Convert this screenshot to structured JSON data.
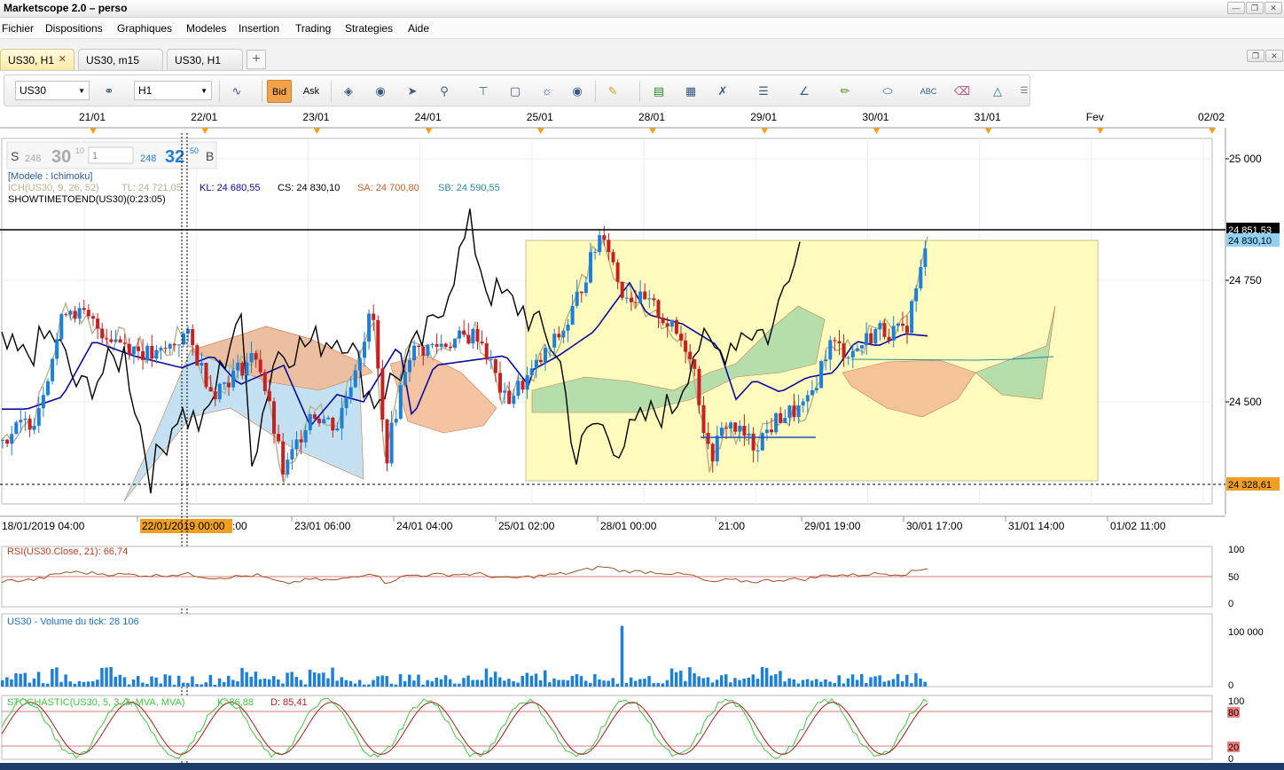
{
  "app": {
    "title": "Marketscope 2.0 – perso"
  },
  "menu": [
    "Fichier",
    "Dispositions",
    "Graphiques",
    "Modeles",
    "Insertion",
    "Trading",
    "Strategies",
    "Aide"
  ],
  "tabs": [
    {
      "label": "US30, H1",
      "active": true
    },
    {
      "label": "US30, m15",
      "active": false
    },
    {
      "label": "US30, H1",
      "active": false
    }
  ],
  "toolbar": {
    "instrument": "US30",
    "timeframe": "H1",
    "bid_label": "Bid",
    "ask_label": "Ask"
  },
  "icons": [
    "link-icon",
    "chart-type-icon",
    "indicator-icon",
    "zoom-icon",
    "drawing-icon",
    "camera-icon",
    "settings-icon",
    "globe-icon",
    "ruler-icon",
    "image-icon",
    "table-icon",
    "trend-line-icon",
    "lines-icon",
    "pencil-icon",
    "ellipse-icon",
    "text-icon",
    "eraser-icon",
    "tree-icon",
    "menu-icon"
  ],
  "quote": {
    "sell_label": "S",
    "sell_big": "248",
    "sell_main": "30",
    "sell_pip": "10",
    "amount": "1",
    "buy_big": "248",
    "buy_main": "32",
    "buy_pip": "50",
    "buy_label": "B"
  },
  "info": {
    "model": "[Modele : Ichimoku]",
    "ich": "ICH(US30, 9, 26, 52)",
    "tl": "TL: 24 721,05",
    "kl": "KL: 24 680,55",
    "cs": "CS: 24 830,10",
    "sa": "SA: 24 700,80",
    "sb": "SB: 24 590,55",
    "timer": "SHOWTIMETOEND(US30)(0:23:05)"
  },
  "colors": {
    "tenkan": "#b8b08a",
    "kijun": "#0a0aa0",
    "chikou": "#000000",
    "cloud_bull": "#a8d8a8",
    "cloud_bear": "#f2b890",
    "kumo_blue": "#b8dcee",
    "zone": "#fefbbd",
    "up": "#1e7fd9",
    "down": "#c62020",
    "rsi": "#a05020",
    "stoch_k": "#40c840",
    "stoch_d": "#a02020"
  },
  "chart_data": {
    "type": "candlestick",
    "top_dates": [
      "21/01",
      "22/01",
      "23/01",
      "24/01",
      "25/01",
      "28/01",
      "29/01",
      "30/01",
      "31/01",
      "Fev",
      "02/02"
    ],
    "bottom_dates": [
      "18/01/2019 04:00",
      "22/01/2019 00:00",
      "23/01 06:00",
      "24/01 04:00",
      "25/01 02:00",
      "28/01 00:00",
      "21:00",
      "29/01 19:00",
      "30/01 17:00",
      "31/01 14:00",
      "01/02 11:00"
    ],
    "crosshair_label": "22/01/2019 00:00",
    "bottom_partial": ":00",
    "y_ticks": [
      "25 000",
      "24 750",
      "24 500"
    ],
    "price_labels": {
      "resistance": "24 851,53",
      "last": "24 830,10",
      "support": "24 328,61"
    },
    "ylim": [
      24300,
      25050
    ],
    "rsi": {
      "label": "RSI(US30.Close, 21): 66,74",
      "ticks": [
        "100",
        "50",
        "0"
      ],
      "level": 50
    },
    "volume": {
      "label": "US30 - Volume du tick: 28 106",
      "ticks": [
        "100 000",
        "0"
      ]
    },
    "stoch": {
      "label": "STOCHASTIC(US30, 5, 3, 3, MVA, MVA)",
      "k": "K: 86,88",
      "d": "D: 85,41",
      "ticks": [
        "100",
        "80",
        "20",
        "0"
      ]
    }
  }
}
